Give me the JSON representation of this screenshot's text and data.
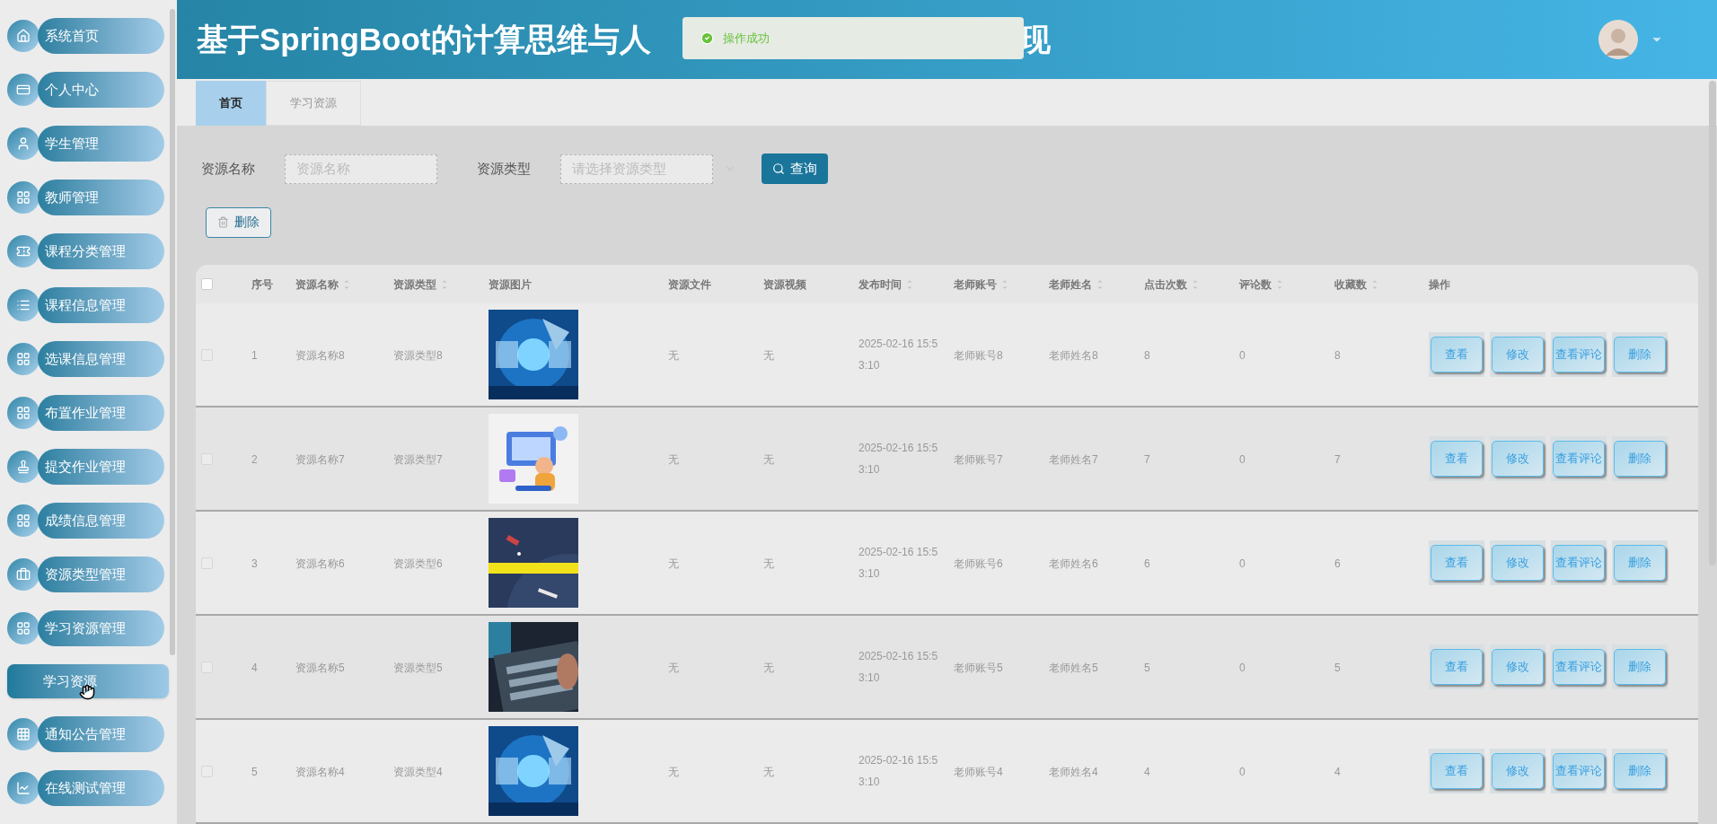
{
  "sidebar": {
    "items": [
      {
        "label": "系统首页",
        "selected": false
      },
      {
        "label": "个人中心",
        "selected": false
      },
      {
        "label": "学生管理",
        "selected": false
      },
      {
        "label": "教师管理",
        "selected": false
      },
      {
        "label": "课程分类管理",
        "selected": false
      },
      {
        "label": "课程信息管理",
        "selected": false
      },
      {
        "label": "选课信息管理",
        "selected": false
      },
      {
        "label": "布置作业管理",
        "selected": false
      },
      {
        "label": "提交作业管理",
        "selected": false
      },
      {
        "label": "成绩信息管理",
        "selected": false
      },
      {
        "label": "资源类型管理",
        "selected": false
      },
      {
        "label": "学习资源管理",
        "selected": false
      },
      {
        "label": "学习资源",
        "selected": true
      },
      {
        "label": "通知公告管理",
        "selected": false
      },
      {
        "label": "在线测试管理",
        "selected": false
      }
    ]
  },
  "header": {
    "title_start": "基于SpringBoot的计算思维与人",
    "title_end": "现",
    "toast": "操作成功"
  },
  "tabs": [
    {
      "label": "首页",
      "selected": true
    },
    {
      "label": "学习资源",
      "selected": false
    }
  ],
  "filters": [
    {
      "label": "资源名称",
      "placeholder": "资源名称",
      "kind": "text"
    },
    {
      "label": "资源类型",
      "placeholder": "请选择资源类型",
      "kind": "select"
    }
  ],
  "search_button": "查询",
  "delete_button": "删除",
  "table": {
    "select_all_checked": false,
    "columns": [
      {
        "label": "序号",
        "sortable": false
      },
      {
        "label": "资源名称",
        "sortable": true
      },
      {
        "label": "资源类型",
        "sortable": true
      },
      {
        "label": "资源图片",
        "sortable": false
      },
      {
        "label": "资源文件",
        "sortable": false
      },
      {
        "label": "资源视频",
        "sortable": false
      },
      {
        "label": "发布时间",
        "sortable": true
      },
      {
        "label": "老师账号",
        "sortable": true
      },
      {
        "label": "老师姓名",
        "sortable": true
      },
      {
        "label": "点击次数",
        "sortable": true
      },
      {
        "label": "评论数",
        "sortable": true
      },
      {
        "label": "收藏数",
        "sortable": true
      },
      {
        "label": "操作",
        "sortable": false
      }
    ],
    "rows": [
      {
        "cells": [
          "1",
          "资源名称8",
          "资源类型8",
          "",
          "无",
          "无",
          "2025-02-16 15:53:10",
          "老师账号8",
          "老师姓名8",
          "8",
          "0",
          "8"
        ],
        "checked": false,
        "actions": [
          "查看",
          "修改",
          "查看评论",
          "删除"
        ]
      },
      {
        "cells": [
          "2",
          "资源名称7",
          "资源类型7",
          "",
          "无",
          "无",
          "2025-02-16 15:53:10",
          "老师账号7",
          "老师姓名7",
          "7",
          "0",
          "7"
        ],
        "checked": false,
        "actions": [
          "查看",
          "修改",
          "查看评论",
          "删除"
        ]
      },
      {
        "cells": [
          "3",
          "资源名称6",
          "资源类型6",
          "",
          "无",
          "无",
          "2025-02-16 15:53:10",
          "老师账号6",
          "老师姓名6",
          "6",
          "0",
          "6"
        ],
        "checked": false,
        "actions": [
          "查看",
          "修改",
          "查看评论",
          "删除"
        ]
      },
      {
        "cells": [
          "4",
          "资源名称5",
          "资源类型5",
          "",
          "无",
          "无",
          "2025-02-16 15:53:10",
          "老师账号5",
          "老师姓名5",
          "5",
          "0",
          "5"
        ],
        "checked": false,
        "actions": [
          "查看",
          "修改",
          "查看评论",
          "删除"
        ]
      },
      {
        "cells": [
          "5",
          "资源名称4",
          "资源类型4",
          "",
          "无",
          "无",
          "2025-02-16 15:53:10",
          "老师账号4",
          "老师姓名4",
          "4",
          "0",
          "4"
        ],
        "checked": false,
        "actions": [
          "查看",
          "修改",
          "查看评论",
          "删除"
        ]
      }
    ]
  }
}
